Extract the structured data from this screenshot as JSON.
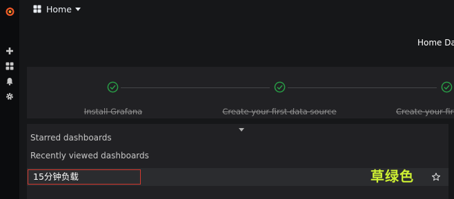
{
  "nav": {
    "title": "Home",
    "icons": [
      "grafana-logo-icon",
      "plus-icon",
      "dashboards-icon",
      "alerting-bell-icon",
      "gear-icon"
    ]
  },
  "dashboard_title": "Home Das",
  "getting_started": {
    "steps": [
      {
        "label": "Install Grafana",
        "done": true
      },
      {
        "label": "Create your first data source",
        "done": true
      },
      {
        "label": "Create your first d",
        "done": true
      }
    ]
  },
  "dashboards": {
    "starred_heading": "Starred dashboards",
    "recent_heading": "Recently viewed dashboards",
    "recent_items": [
      "15分钟负载"
    ]
  },
  "annotation": {
    "text": "草绿色",
    "color": "#ccee33"
  },
  "colors": {
    "accent_green": "#299c46",
    "highlight_border": "#d4392f",
    "logo_orange": "#f05a28"
  }
}
